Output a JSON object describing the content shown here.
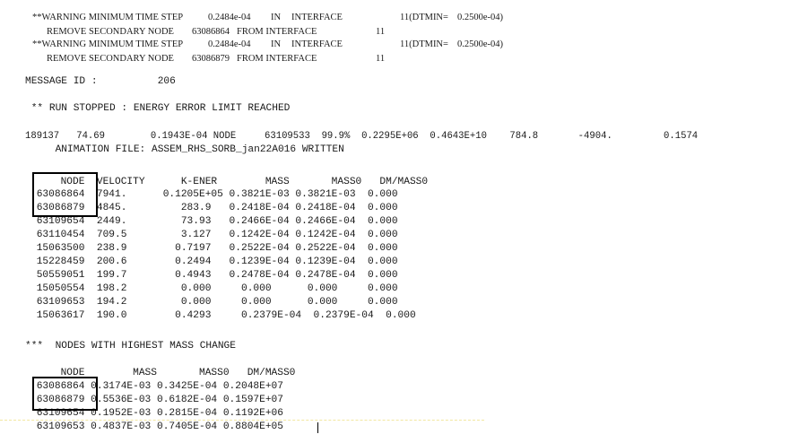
{
  "warnings": {
    "w1_label": "**WARNING MINIMUM TIME STEP",
    "w1_value": "0.2484e-04",
    "w1_in": "IN",
    "w1_iface": "INTERFACE",
    "w1_dtmin": "11(DTMIN=",
    "w1_dtmin_val": "0.2500e-04)",
    "r1_label": "REMOVE SECONDARY NODE",
    "r1_node": "63086864",
    "r1_from": "FROM INTERFACE",
    "r1_num": "11",
    "w2_label": "**WARNING MINIMUM TIME STEP",
    "w2_value": "0.2484e-04",
    "w2_in": "IN",
    "w2_iface": "INTERFACE",
    "w2_dtmin": "11(DTMIN=",
    "w2_dtmin_val": "0.2500e-04)",
    "r2_label": "REMOVE SECONDARY NODE",
    "r2_node": "63086879",
    "r2_from": "FROM INTERFACE",
    "r2_num": "11"
  },
  "message": {
    "id_line": "MESSAGE ID :          206",
    "stopped": " ** RUN STOPPED : ENERGY ERROR LIMIT REACHED",
    "status_line": "189137   74.69        0.1943E-04 NODE     63109533  99.9%  0.2295E+06  0.4643E+10    784.8       -4904.         0.1574",
    "animation": "     ANIMATION FILE: ASSEM_RHS_SORB_jan22A016 WRITTEN"
  },
  "table1": {
    "header": "     NODE  VELOCITY      K-ENER        MASS       MASS0   DM/MASS0",
    "rows": [
      " 63086864  7941.      0.1205E+05 0.3821E-03 0.3821E-03  0.000",
      " 63086879  4845.         283.9   0.2418E-04 0.2418E-04  0.000",
      " 63109654  2449.         73.93   0.2466E-04 0.2466E-04  0.000",
      " 63110454  709.5         3.127   0.1242E-04 0.1242E-04  0.000",
      " 15063500  238.9        0.7197   0.2522E-04 0.2522E-04  0.000",
      " 15228459  200.6        0.2494   0.1239E-04 0.1239E-04  0.000",
      " 50559051  199.7        0.4943   0.2478E-04 0.2478E-04  0.000",
      " 15050554  198.2         0.000     0.000      0.000     0.000",
      " 63109653  194.2         0.000     0.000      0.000     0.000",
      " 15063617  190.0        0.4293     0.2379E-04  0.2379E-04  0.000"
    ]
  },
  "table2": {
    "title": "***  NODES WITH HIGHEST MASS CHANGE",
    "header": "     NODE        MASS       MASS0   DM/MASS0",
    "rows": [
      " 63086864 0.3174E-03 0.3425E-04 0.2048E+07",
      " 63086879 0.5536E-03 0.6182E-04 0.1597E+07",
      " 63109654 0.1952E-03 0.2815E-04 0.1192E+06",
      " 63109653 0.4837E-03 0.7405E-04 0.8804E+05"
    ]
  }
}
